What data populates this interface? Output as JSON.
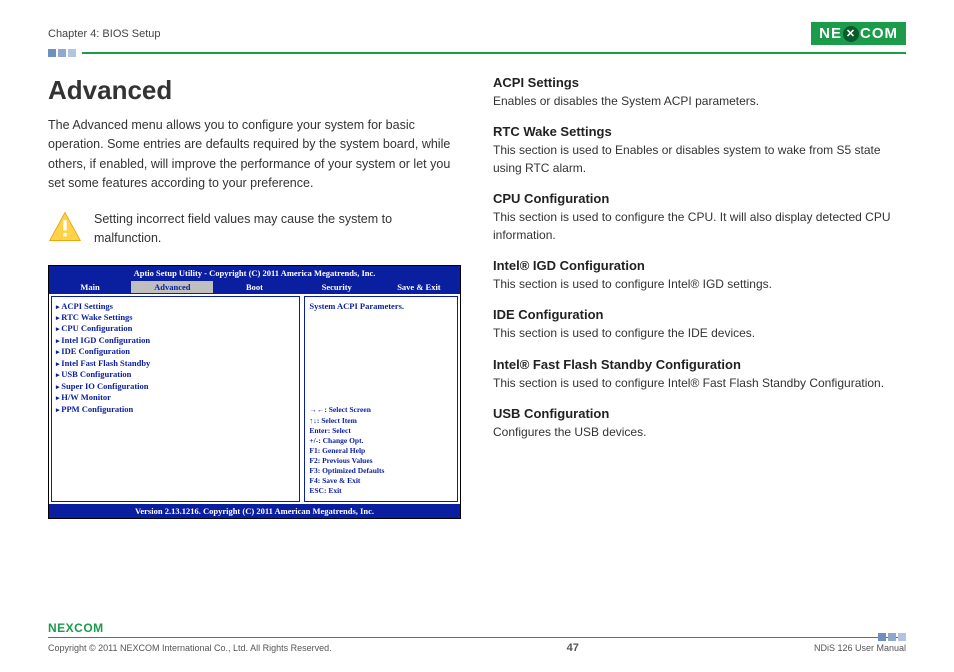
{
  "header": {
    "chapter": "Chapter 4: BIOS Setup",
    "brand": "NEXCOM"
  },
  "title": "Advanced",
  "intro": "The Advanced menu allows you to configure your system for basic operation. Some entries are defaults required by the system board, while others, if enabled, will improve the performance of your system or let you set some features according to your preference.",
  "warning": "Setting incorrect field values may cause the system to malfunction.",
  "bios": {
    "top": "Aptio Setup Utility - Copyright (C) 2011 America Megatrends, Inc.",
    "tabs": [
      "Main",
      "Advanced",
      "Boot",
      "Security",
      "Save & Exit"
    ],
    "menu": [
      "ACPI Settings",
      "RTC Wake Settings",
      "CPU Configuration",
      "Intel IGD Configuration",
      "IDE Configuration",
      "Intel Fast Flash Standby",
      "USB Configuration",
      "Super IO Configuration",
      "H/W Monitor",
      "PPM Configuration"
    ],
    "right_hint": "System ACPI Parameters.",
    "help": [
      "→←: Select Screen",
      "↑↓: Select Item",
      "Enter: Select",
      "+/-: Change Opt.",
      "F1: General Help",
      "F2: Previous Values",
      "F3: Optimized Defaults",
      "F4: Save & Exit",
      "ESC: Exit"
    ],
    "bottom": "Version 2.13.1216. Copyright (C) 2011 American Megatrends, Inc."
  },
  "sections": [
    {
      "h": "ACPI Settings",
      "p": "Enables or disables the System ACPI parameters."
    },
    {
      "h": "RTC Wake Settings",
      "p": "This section is used to Enables or disables system to wake from S5 state using RTC alarm."
    },
    {
      "h": "CPU Configuration",
      "p": "This section is used to configure the CPU. It will also display detected CPU information."
    },
    {
      "h": "Intel® IGD Configuration",
      "p": "This section is used to configure Intel® IGD settings."
    },
    {
      "h": "IDE Configuration",
      "p": "This section is used to configure the IDE devices."
    },
    {
      "h": "Intel® Fast Flash Standby Configuration",
      "p": "This section is used to configure Intel® Fast Flash Standby Configuration."
    },
    {
      "h": "USB Configuration",
      "p": "Configures the USB devices."
    }
  ],
  "footer": {
    "copyright": "Copyright © 2011 NEXCOM International Co., Ltd. All Rights Reserved.",
    "page": "47",
    "doc": "NDiS 126 User Manual",
    "brand": "NEXCOM"
  }
}
